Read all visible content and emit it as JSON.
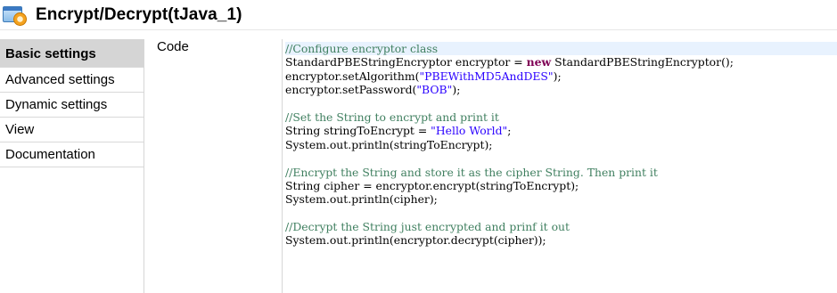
{
  "window": {
    "title": "Encrypt/Decrypt(tJava_1)",
    "icon": "component-gear-icon"
  },
  "sidebar": {
    "items": [
      {
        "label": "Basic settings",
        "active": true
      },
      {
        "label": "Advanced settings",
        "active": false
      },
      {
        "label": "Dynamic settings",
        "active": false
      },
      {
        "label": "View",
        "active": false
      },
      {
        "label": "Documentation",
        "active": false
      }
    ]
  },
  "main": {
    "code_label": "Code",
    "code_lines": [
      [
        {
          "t": "comment",
          "v": "//Configure encryptor class"
        }
      ],
      [
        {
          "t": "plain",
          "v": "StandardPBEStringEncryptor encryptor = "
        },
        {
          "t": "keyword",
          "v": "new"
        },
        {
          "t": "plain",
          "v": " StandardPBEStringEncryptor();"
        }
      ],
      [
        {
          "t": "plain",
          "v": "encryptor.setAlgorithm("
        },
        {
          "t": "string",
          "v": "\"PBEWithMD5AndDES\""
        },
        {
          "t": "plain",
          "v": ");"
        }
      ],
      [
        {
          "t": "plain",
          "v": "encryptor.setPassword("
        },
        {
          "t": "string",
          "v": "\"BOB\""
        },
        {
          "t": "plain",
          "v": ");"
        }
      ],
      [],
      [
        {
          "t": "comment",
          "v": "//Set the String to encrypt and print it"
        }
      ],
      [
        {
          "t": "plain",
          "v": "String stringToEncrypt = "
        },
        {
          "t": "string",
          "v": "\"Hello World\""
        },
        {
          "t": "plain",
          "v": ";"
        }
      ],
      [
        {
          "t": "plain",
          "v": "System.out.println(stringToEncrypt);"
        }
      ],
      [],
      [
        {
          "t": "comment",
          "v": "//Encrypt the String and store it as the cipher String. Then print it"
        }
      ],
      [
        {
          "t": "plain",
          "v": "String cipher = encryptor.encrypt(stringToEncrypt);"
        }
      ],
      [
        {
          "t": "plain",
          "v": "System.out.println(cipher);"
        }
      ],
      [],
      [
        {
          "t": "comment",
          "v": "//Decrypt the String just encrypted and prinf it out"
        }
      ],
      [
        {
          "t": "plain",
          "v": "System.out.println(encryptor.decrypt(cipher));"
        }
      ]
    ]
  },
  "colors": {
    "comment": "#3f7f5f",
    "keyword": "#7f0055",
    "string": "#2a00ff",
    "active_sidebar_bg": "#d5d5d5",
    "current_line_bg": "#e8f2fe"
  }
}
